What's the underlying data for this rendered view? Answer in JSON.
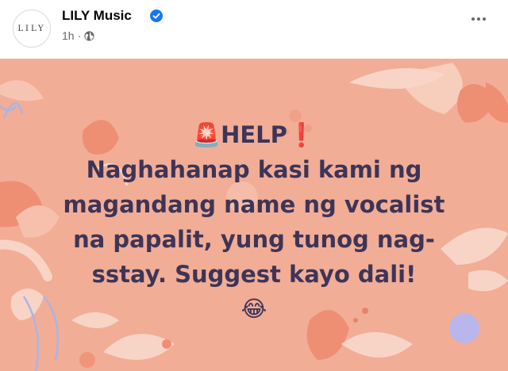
{
  "header": {
    "page_name": "LILY Music",
    "avatar_text": "LILY",
    "timestamp": "1h",
    "separator": "·",
    "verified_icon": "verified-badge-icon",
    "privacy_icon": "globe-icon",
    "more_icon": "more-options-icon"
  },
  "post": {
    "lines": [
      "🚨HELP❗",
      "Naghahanap kasi kami ng",
      "magandang name ng vocalist",
      "na papalit, yung tunog nag-",
      "sstay. Suggest kayo dali!"
    ],
    "emoji": "😂",
    "colors": {
      "background": "#f2ad96",
      "text": "#3d3558",
      "accent_light": "#f8cfc0",
      "accent_dark": "#ee8f74",
      "dot_purple": "#b9b6ec"
    }
  }
}
